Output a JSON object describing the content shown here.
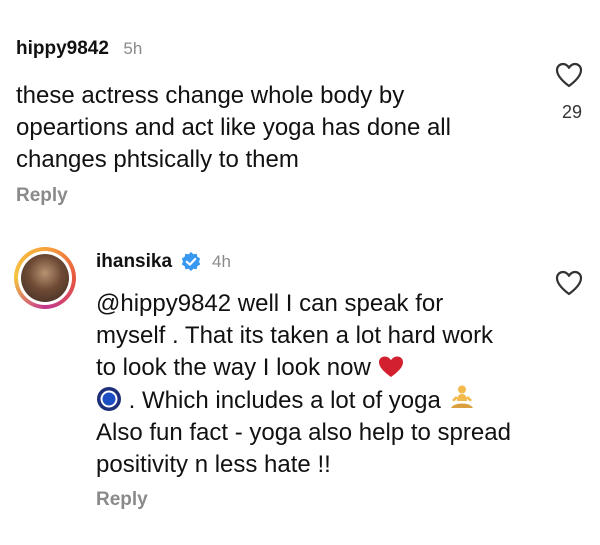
{
  "comments": [
    {
      "username": "hippy9842",
      "time": "5h",
      "text": "these actress change whole body by opeartions  and act like yoga has done all changes phtsically to them",
      "likes": "29",
      "reply_label": "Reply"
    },
    {
      "username": "ihansika",
      "verified": true,
      "time": "4h",
      "text_line1": "@hippy9842 well I can speak for myself . That its taken a lot hard work to look the way I look now",
      "text_line2": ". Which includes a lot of yoga",
      "text_line3": "Also fun fact - yoga also help to spread positivity n less hate !!",
      "reply_label": "Reply"
    }
  ],
  "icons": {
    "like": "heart-outline-icon",
    "verified": "verified-badge-icon",
    "red_heart": "red-heart-emoji",
    "blue_circle": "blue-circle-emoji",
    "yoga": "person-in-lotus-position-emoji"
  },
  "colors": {
    "text": "#111111",
    "muted": "#8a8a8a",
    "verified_blue": "#3897f0",
    "heart_red": "#d3202f"
  }
}
